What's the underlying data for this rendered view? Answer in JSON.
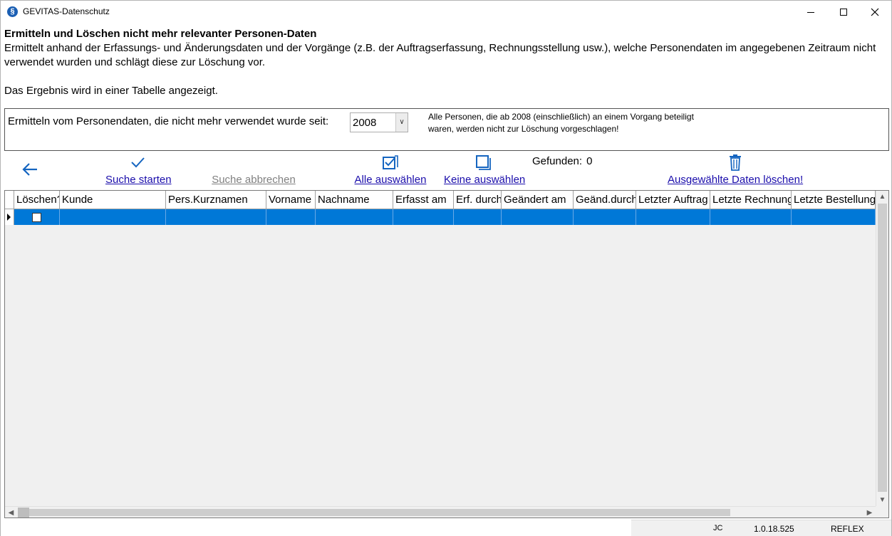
{
  "window": {
    "title": "GEVITAS-Datenschutz",
    "icon_glyph": "§"
  },
  "header": {
    "title": "Ermitteln und Löschen nicht mehr relevanter Personen-Daten",
    "description": "Ermittelt anhand der Erfassungs- und Änderungsdaten und der Vorgänge (z.B. der Auftragserfassung, Rechnungsstellung usw.), welche Personendaten im angegebenen Zeitraum nicht verwendet wurden und schlägt diese zur Löschung vor.",
    "result_note": "Das Ergebnis wird in einer Tabelle angezeigt."
  },
  "filter": {
    "label": "Ermitteln vom Personendaten, die nicht mehr verwendet wurde seit:",
    "year_value": "2008",
    "hint": "Alle Personen, die ab 2008 (einschließlich) an einem Vorgang beteiligt waren, werden nicht zur Löschung vorgeschlagen!"
  },
  "toolbar": {
    "start_label": "Suche starten",
    "abort_label": "Suche abbrechen",
    "select_all_label": "Alle auswählen",
    "select_none_label": "Keine auswählen",
    "found_label": "Gefunden:",
    "found_count": "0",
    "delete_label": "Ausgewählte Daten löschen!"
  },
  "grid": {
    "columns": [
      "Löschen?",
      "Kunde",
      "Pers.Kurznamen",
      "Vorname",
      "Nachname",
      "Erfasst am",
      "Erf. durch",
      "Geändert am",
      "Geänd.durch",
      "Letzter Auftrag",
      "Letzte Rechnung",
      "Letzte Bestellung"
    ]
  },
  "status": {
    "user": "JC",
    "version": "1.0.18.525",
    "app": "REFLEX"
  },
  "colors": {
    "selection": "#0078d7",
    "link": "#1a0dab",
    "icon_blue": "#1565c0"
  }
}
